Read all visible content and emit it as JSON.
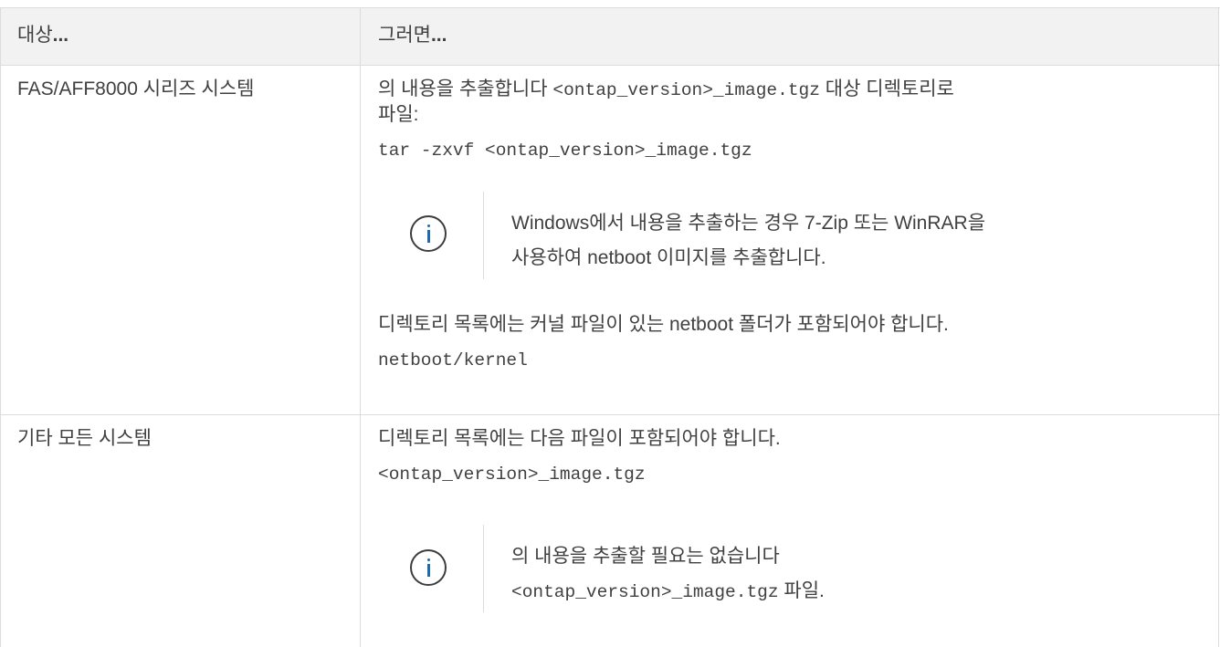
{
  "table": {
    "headers": {
      "col1_text": "대상",
      "col1_dots": "...",
      "col2_text": "그러면",
      "col2_dots": "..."
    },
    "rows": [
      {
        "target": "FAS/AFF8000 시리즈 시스템",
        "line1_prefix": "의 내용을 추출합니다 ",
        "line1_code": "<ontap_version>_image.tgz",
        "line1_suffix": " 대상 디렉토리로",
        "line2": "파일:",
        "command": "tar -zxvf <ontap_version>_image.tgz",
        "note_line1": "Windows에서 내용을 추출하는 경우 7-Zip 또는 WinRAR을",
        "note_line2": "사용하여 netboot 이미지를 추출합니다.",
        "after_note": "디렉토리 목록에는 커널 파일이 있는 netboot 폴더가 포함되어야 합니다.",
        "path": "netboot/kernel"
      },
      {
        "target": "기타 모든 시스템",
        "line1": "디렉토리 목록에는 다음 파일이 포함되어야 합니다.",
        "file": "<ontap_version>_image.tgz",
        "note_line1": "의 내용을 추출할 필요는 없습니다",
        "note_code": "<ontap_version>_image.tgz",
        "note_suffix": " 파일."
      }
    ]
  },
  "colors": {
    "text": "#404040",
    "border": "#dcdcdc",
    "header_bg": "#f2f2f2",
    "icon_accent": "#1d6ab0"
  },
  "icons": [
    "info-icon",
    "info-icon"
  ]
}
